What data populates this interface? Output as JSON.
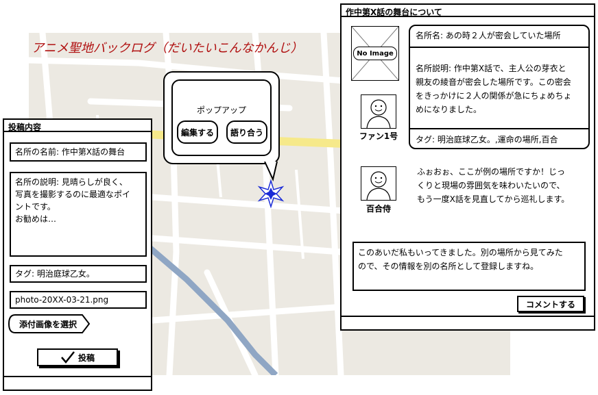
{
  "app_title": "アニメ聖地バックログ（だいたいこんなかんじ）",
  "popup": {
    "title": "ポップアップ",
    "edit_button": "編集する",
    "discuss_button": "語り合う"
  },
  "post_panel": {
    "title": "投稿内容",
    "name_field": "名所の名前: 作中第X話の舞台",
    "description_lines": [
      "名所の説明: 見晴らしが良く、",
      "写真を撮影するのに最適なポイ",
      "ントです。",
      "お勧めは…"
    ],
    "tag_field": "タグ: 明治庭球乙女。",
    "file_field": "photo-20XX-03-21.png",
    "select_image_button": "添付画像を選択",
    "submit_button": "投稿",
    "submit_icon": "checkmark-icon"
  },
  "detail_panel": {
    "title": "作中第X話の舞台について",
    "no_image_label": "No Image",
    "place_name": "名所名: あの時２人が密会していた場所",
    "description_lines": [
      "名所説明: 作中第X話で、主人公の芽衣と",
      "親友の綾音が密会した場所です。この密会",
      "をきっかけに２人の関係が急にちょめちょ",
      "めになりました。"
    ],
    "tags": "タグ: 明治庭球乙女。,運命の場所,百合",
    "author1": "ファン1号",
    "author2": "百合侍",
    "comment_lines": [
      "ふぉおぉ、ここが例の場所ですか！じっ",
      "くりと現場の雰囲気を味わいたいので、",
      "もう一度X話を見直してから巡礼します。"
    ],
    "input_lines": [
      "このあいだ私もいってきました。別の場所から見てみた",
      "ので、その情報を別の名所として登録しますね。"
    ],
    "comment_button": "コメントする"
  },
  "colors": {
    "title_red": "#b01010",
    "marker_blue": "#1a2bd6",
    "map_bg": "#ece9e2",
    "road_yellow": "#f6e98a",
    "river_blue": "#8fa6c4"
  }
}
